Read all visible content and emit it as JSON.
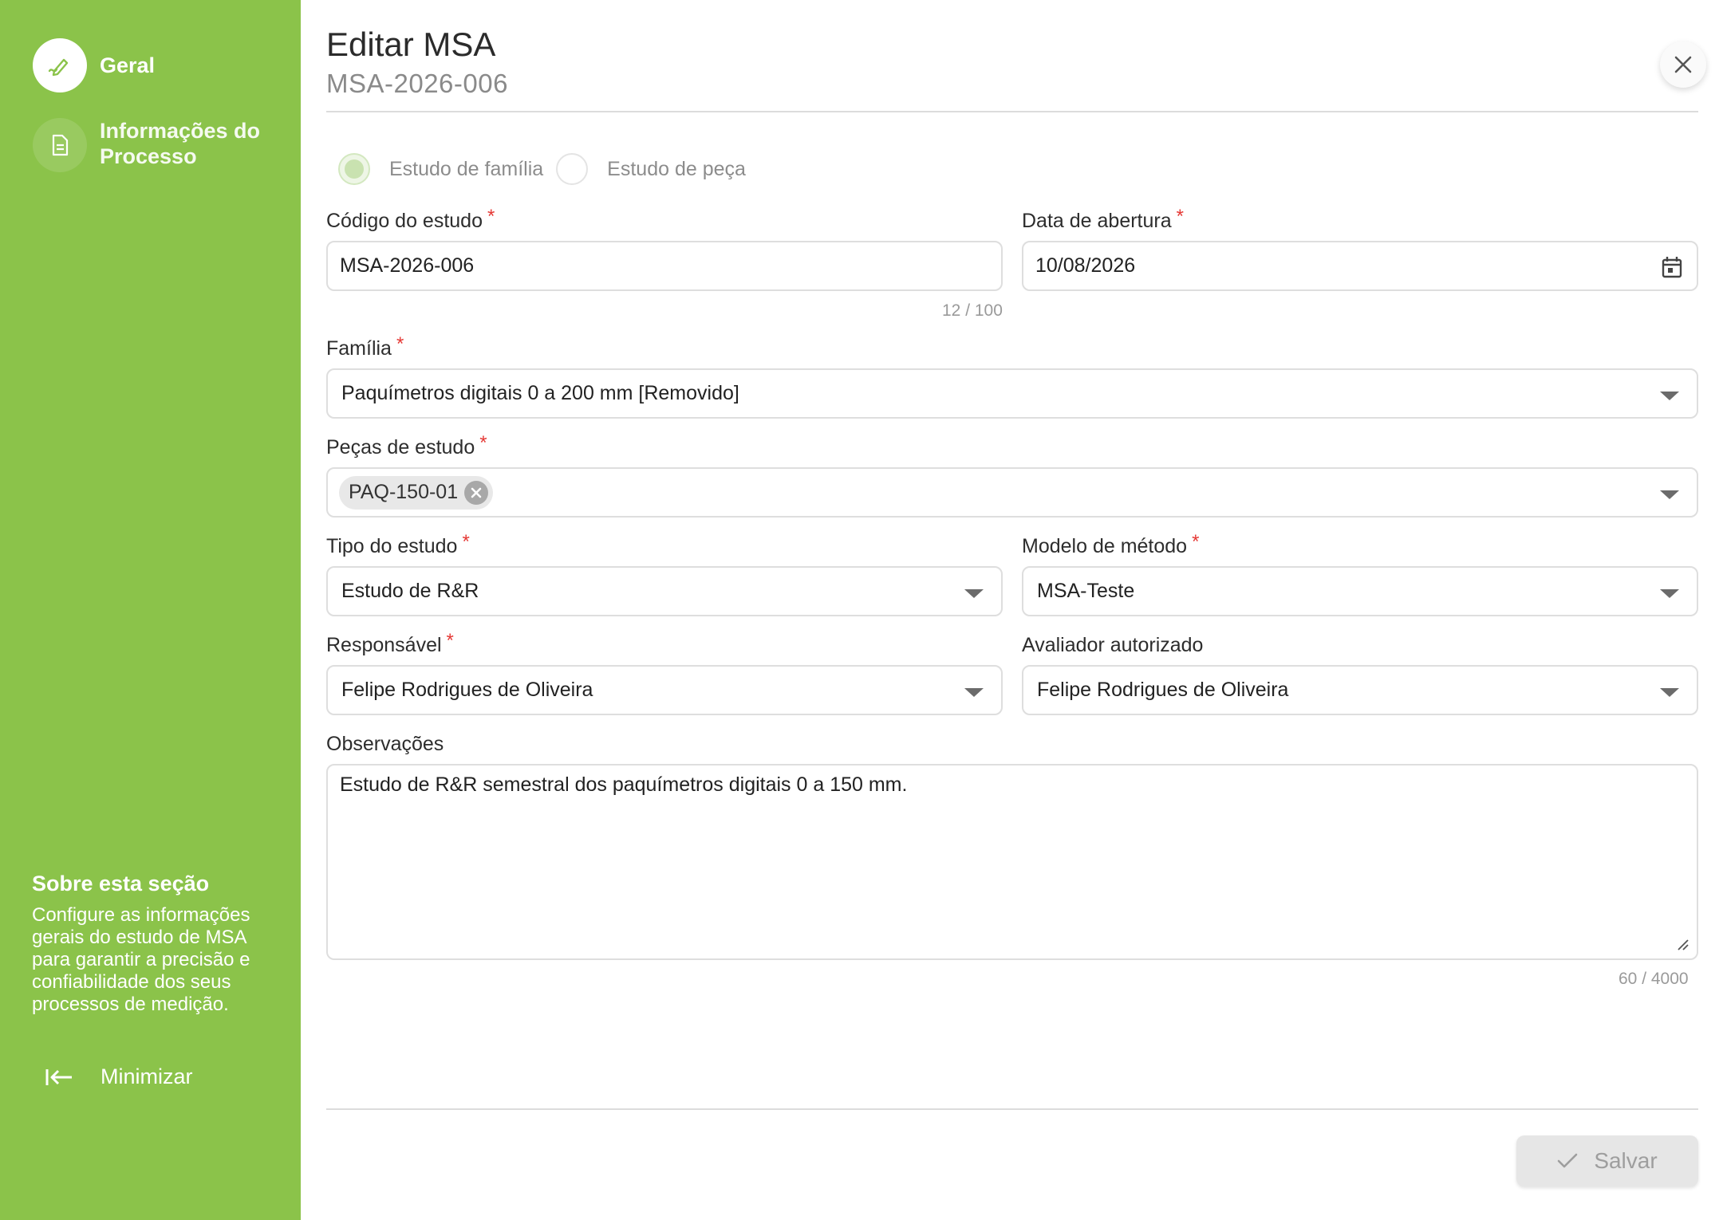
{
  "sidebar": {
    "items": [
      {
        "label": "Geral",
        "icon": "pen-icon"
      },
      {
        "label": "Informações do Processo",
        "icon": "document-icon"
      }
    ],
    "about_title": "Sobre esta seção",
    "about_text": "Configure as informações gerais do estudo de MSA para garantir a precisão e confiabilidade dos seus processos de medição.",
    "minimize_label": "Minimizar"
  },
  "header": {
    "title": "Editar MSA",
    "subtitle": "MSA-2026-006"
  },
  "study_scope": {
    "options": [
      "Estudo de família",
      "Estudo de peça"
    ],
    "selected": "Estudo de família"
  },
  "form": {
    "codigo": {
      "label": "Código do estudo",
      "value": "MSA-2026-006",
      "counter": "12 / 100"
    },
    "data_abertura": {
      "label": "Data de abertura",
      "value": "10/08/2026"
    },
    "familia": {
      "label": "Família",
      "value": "Paquímetros digitais 0 a 200 mm [Removido]"
    },
    "pecas": {
      "label": "Peças de estudo",
      "chips": [
        "PAQ-150-01"
      ]
    },
    "tipo": {
      "label": "Tipo do estudo",
      "value": "Estudo de R&R"
    },
    "modelo": {
      "label": "Modelo de método",
      "value": "MSA-Teste"
    },
    "responsavel": {
      "label": "Responsável",
      "value": "Felipe Rodrigues de Oliveira"
    },
    "avaliador": {
      "label": "Avaliador autorizado",
      "value": "Felipe Rodrigues de Oliveira"
    },
    "observacoes": {
      "label": "Observações",
      "value": "Estudo de R&R semestral dos paquímetros digitais 0 a 150 mm.",
      "counter": "60 / 4000"
    },
    "required_mark": "*"
  },
  "footer": {
    "save_label": "Salvar"
  },
  "colors": {
    "sidebar": "#8bc34a",
    "required": "#e53935"
  }
}
